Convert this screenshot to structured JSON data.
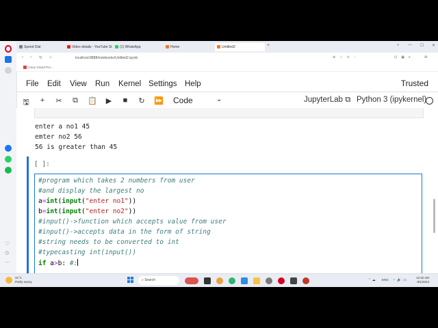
{
  "browser": {
    "tabs": [
      {
        "label": "Speed Dial",
        "color": "#7b7f87"
      },
      {
        "label": "Video details - YouTube St",
        "color": "#e62117"
      },
      {
        "label": "(1) WhatsApp",
        "color": "#25d366"
      },
      {
        "label": "Home",
        "color": "#f37726"
      },
      {
        "label": "Untitled2",
        "color": "#f37726"
      }
    ],
    "url": "localhost:8888/notebooks/Untitled2.ipynb",
    "bookmark": "Crazy Grand Pro..."
  },
  "jupyter": {
    "menu": [
      "File",
      "Edit",
      "View",
      "Run",
      "Kernel",
      "Settings",
      "Help"
    ],
    "trusted": "Trusted",
    "cell_type": "Code",
    "jupyterlab_label": "JupyterLab",
    "kernel_label": "Python 3 (ipykernel)"
  },
  "output_lines": [
    "enter a no1 45",
    "emter no2 56",
    "56 is greater than 45"
  ],
  "cell": {
    "prompt": "[ ]:",
    "comment1": "#program which takes 2 numbers from user",
    "comment2": "#and display the largest no",
    "line3": {
      "a": "a",
      "eq": "=",
      "int": "int",
      "p1": "(",
      "input": "input",
      "p2": "(",
      "str": "\"enter no1\"",
      "close": "))"
    },
    "line4": {
      "a": "b",
      "eq": "=",
      "int": "int",
      "p1": "(",
      "input": "input",
      "p2": "(",
      "str": "\"enter no2\"",
      "close": "))"
    },
    "comment5": "#input()->function which accepts value from user",
    "comment6": "#input()->accepts data in the form of string",
    "comment7": "#string needs to be converted to int",
    "comment8": "#typecasting int(input())",
    "line9": {
      "if": "if",
      "rest1": " a",
      "op": ">",
      "rest2": "b: ",
      "comment": "#:"
    }
  },
  "taskbar": {
    "weather_temp": "31°C",
    "weather_desc": "Partly sunny",
    "search": "Search",
    "lang": "ENG",
    "time": "12:32 AM",
    "date": "8/1/2024"
  }
}
